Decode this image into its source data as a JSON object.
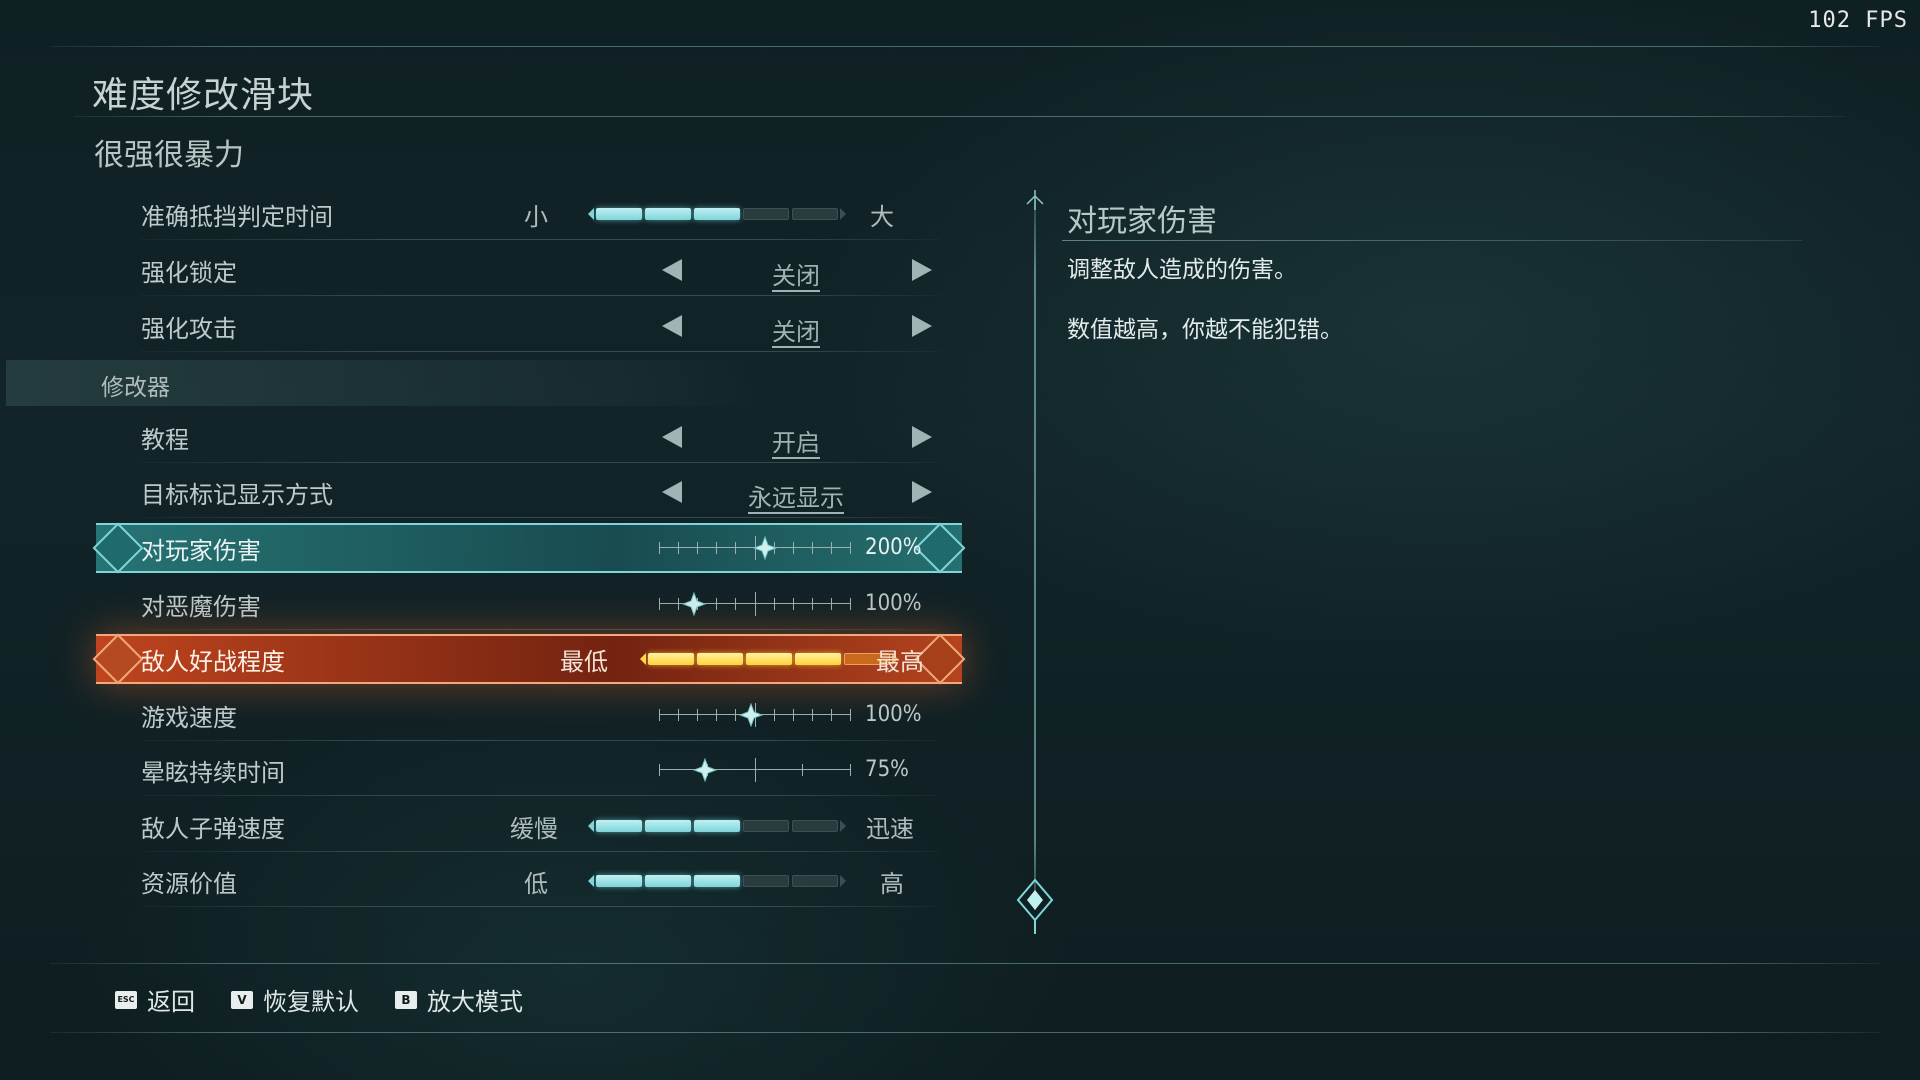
{
  "fps": "102 FPS",
  "page_title": "难度修改滑块",
  "section_title": "很强很暴力",
  "rows": {
    "parry": {
      "label": "准确抵挡判定时间",
      "low": "小",
      "high": "大",
      "level": 3,
      "max": 5
    },
    "lock": {
      "label": "强化锁定",
      "value": "关闭"
    },
    "attack": {
      "label": "强化攻击",
      "value": "关闭"
    },
    "group": {
      "label": "修改器"
    },
    "tutorial": {
      "label": "教程",
      "value": "开启"
    },
    "marker": {
      "label": "目标标记显示方式",
      "value": "永远显示"
    },
    "player_damage": {
      "label": "对玩家伤害",
      "value": "200%",
      "position": 0.55
    },
    "demon_damage": {
      "label": "对恶魔伤害",
      "value": "100%",
      "position": 0.18
    },
    "aggression": {
      "label": "敌人好战程度",
      "low": "最低",
      "high": "最高",
      "level": 4,
      "max": 5
    },
    "game_speed": {
      "label": "游戏速度",
      "value": "100%",
      "position": 0.48
    },
    "stun": {
      "label": "晕眩持续时间",
      "value": "75%",
      "position": 0.24
    },
    "bullet_speed": {
      "label": "敌人子弹速度",
      "low": "缓慢",
      "high": "迅速",
      "level": 3,
      "max": 5
    },
    "resource": {
      "label": "资源价值",
      "low": "低",
      "high": "高",
      "level": 3,
      "max": 5
    }
  },
  "description": {
    "title": "对玩家伤害",
    "line1": "调整敌人造成的伤害。",
    "line2": "数值越高，你越不能犯错。"
  },
  "footer": {
    "back_key": "ESC",
    "back_label": "返回",
    "reset_key": "V",
    "reset_label": "恢复默认",
    "zoom_key": "B",
    "zoom_label": "放大模式"
  },
  "colors": {
    "accent_teal": "#7fd5da",
    "accent_orange": "#e0632a",
    "fill_yellow": "#ffe066"
  }
}
